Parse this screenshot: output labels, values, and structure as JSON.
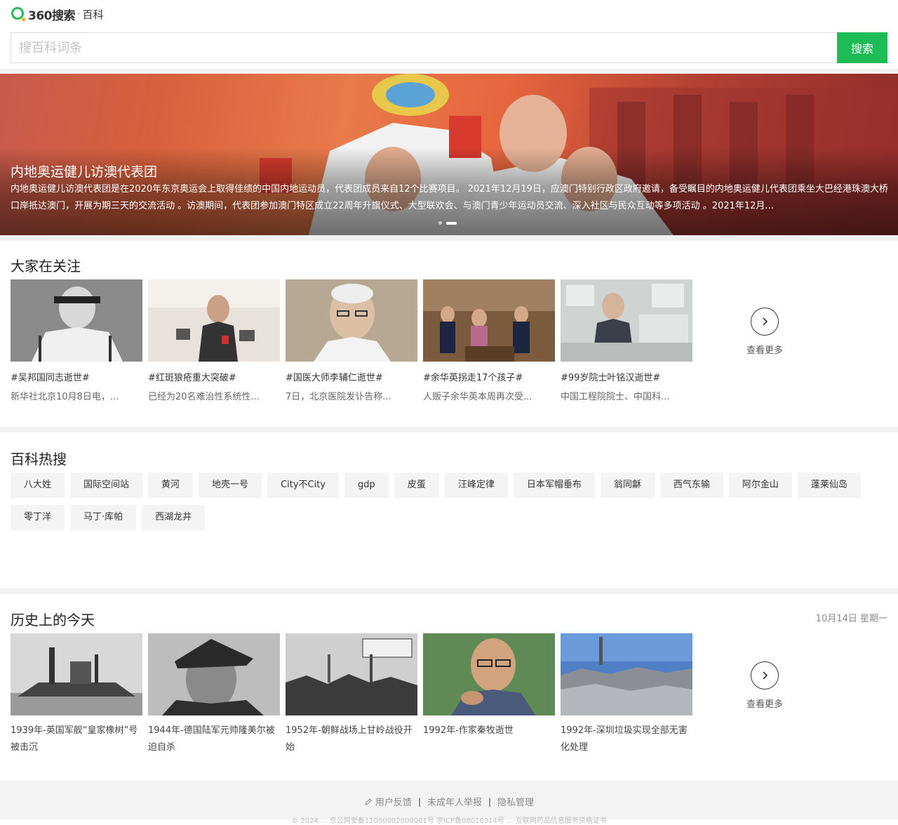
{
  "header": {
    "logo_text": "360搜索",
    "logo_sep": "·",
    "logo_sub": "百科",
    "search_placeholder": "搜百科词条",
    "search_button": "搜索"
  },
  "banner": {
    "title": "内地奥运健儿访澳代表团",
    "description": "内地奥运健儿访澳代表团是在2020年东京奥运会上取得佳绩的中国内地运动员，代表团成员来自12个比赛项目。 2021年12月19日，应澳门特别行政区政府邀请，备受瞩目的内地奥运健儿代表团乘坐大巴经港珠澳大桥口岸抵达澳门，开展为期三天的交流活动 。访澳期间，代表团参加澳门特区成立22周年升旗仪式、大型联欢会、与澳门青少年运动员交流、深入社区与民众互动等多项活动 。2021年12月..."
  },
  "focus": {
    "title": "大家在关注",
    "more_label": "查看更多",
    "items": [
      {
        "title": "#吴邦国同志逝世#",
        "desc": "新华社北京10月8日电，..."
      },
      {
        "title": "#红斑狼疮重大突破#",
        "desc": "已经为20名难治性系统性..."
      },
      {
        "title": "#国医大师李辅仁逝世#",
        "desc": "7日，北京医院发讣告称..."
      },
      {
        "title": "#余华英拐走17个孩子#",
        "desc": "人贩子余华英本周再次受..."
      },
      {
        "title": "#99岁院士叶铭汉逝世#",
        "desc": "中国工程院院士、中国科..."
      }
    ]
  },
  "hot": {
    "title": "百科热搜",
    "tags": [
      "八大姓",
      "国际空间站",
      "黄河",
      "地壳一号",
      "City不City",
      "gdp",
      "皮蛋",
      "汪峰定律",
      "日本军帽垂布",
      "翁同龢",
      "西气东输",
      "阿尔金山",
      "蓬莱仙岛",
      "零丁洋",
      "马丁·库帕",
      "西湖龙井"
    ]
  },
  "history": {
    "title": "历史上的今天",
    "date": "10月14日 星期一",
    "more_label": "查看更多",
    "items": [
      {
        "text": "1939年-英国军舰“皇家橡树”号被击沉"
      },
      {
        "text": "1944年-德国陆军元帅隆美尔被迫自杀"
      },
      {
        "text": "1952年-朝鲜战场上甘岭战役开始"
      },
      {
        "text": "1992年-作家秦牧逝世"
      },
      {
        "text": "1992年-深圳垃圾实现全部无害化处理"
      }
    ]
  },
  "footer": {
    "links": [
      "用户反馈",
      "未成年人举报",
      "隐私管理"
    ],
    "copyright": "© 2024 ... 京公网安备11000002000001号 京ICP备08010314号 ... 互联网药品信息服务资格证书"
  },
  "colors": {
    "accent": "#1ebc57"
  }
}
